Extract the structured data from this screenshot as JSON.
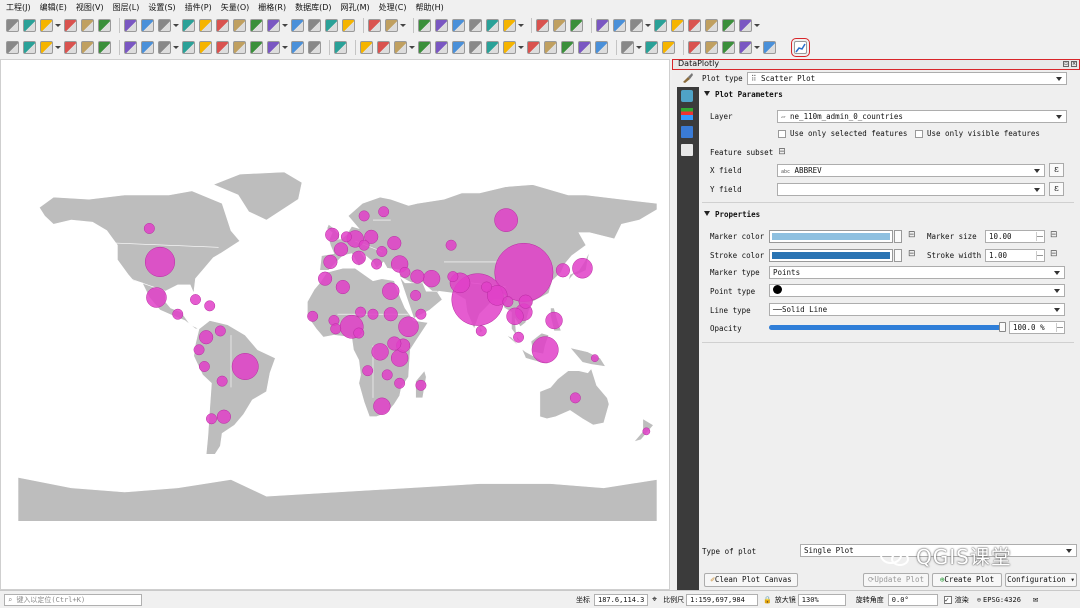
{
  "menu": [
    "工程(J)",
    "编辑(E)",
    "视图(V)",
    "图层(L)",
    "设置(S)",
    "插件(P)",
    "矢量(O)",
    "栅格(R)",
    "数据库(D)",
    "网孔(M)",
    "处理(C)",
    "帮助(H)"
  ],
  "icons": {
    "toolbar1": [
      "new-project-icon",
      "open-project-icon",
      "save-project-icon",
      "save-as-icon",
      "print-layout-icon",
      "layout-manager-icon",
      "style-manager-icon",
      "pan-icon",
      "pan-to-selection-icon",
      "zoom-in-icon",
      "zoom-out-icon",
      "zoom-full-icon",
      "zoom-to-selection-icon",
      "zoom-to-layer-icon",
      "zoom-native-icon",
      "zoom-last-icon",
      "zoom-next-icon",
      "new-bookmark-icon",
      "show-bookmarks-icon",
      "refresh-icon",
      "identify-icon",
      "run-action-icon",
      "select-features-icon",
      "attribute-table-icon",
      "field-calculator-icon",
      "processing-toolbox-icon",
      "statistical-summary-icon",
      "measure-icon",
      "map-tips-icon",
      "text-annotation-icon",
      "label-pin-icon",
      "label-show-icon",
      "label-move-icon",
      "label-rotate-icon",
      "label-change-icon",
      "diagram-pin-icon",
      "diagram-move-icon",
      "diagram-change-icon",
      "diagram-rotate-icon"
    ],
    "toolbar2": [
      "data-source-manager-icon",
      "new-geopackage-icon",
      "new-shapefile-icon",
      "new-spatialite-icon",
      "new-virtual-layer-icon",
      "add-vector-icon",
      "digitize-icon",
      "edit-pencil-icon",
      "save-edits-icon",
      "add-feature-icon",
      "vertex-tool-icon",
      "delete-selected-icon",
      "cut-features-icon",
      "copy-features-icon",
      "paste-features-icon",
      "undo-icon",
      "redo-icon",
      "db-manager-icon",
      "plot-icon",
      "geometry-tool-1",
      "geometry-tool-2",
      "geometry-tool-3",
      "geometry-tool-4",
      "geometry-tool-5",
      "geometry-tool-6",
      "geometry-tool-7",
      "geometry-tool-8",
      "geometry-tool-9",
      "geometry-tool-10",
      "geometry-tool-11",
      "geometry-tool-12",
      "geometry-tool-13",
      "help-icon",
      "python-console-icon",
      "plugin-icon",
      "shape-tool-1",
      "shape-tool-2",
      "shape-tool-3",
      "shape-tool-4",
      "shape-tool-5",
      "dataplotly-icon"
    ]
  },
  "map": {
    "land_color": "#bdbdbd",
    "marker_color": "#e040c8",
    "markers": [
      {
        "lon": 105,
        "lat": 35,
        "size": 17
      },
      {
        "lon": 79,
        "lat": 22,
        "size": 15
      },
      {
        "lon": -100,
        "lat": 40,
        "size": 8
      },
      {
        "lon": 95,
        "lat": 60,
        "size": 6
      },
      {
        "lon": 117,
        "lat": -2,
        "size": 7
      },
      {
        "lon": -52,
        "lat": -10,
        "size": 7
      },
      {
        "lon": 8,
        "lat": 9,
        "size": 6
      },
      {
        "lon": -102,
        "lat": 23,
        "size": 5
      },
      {
        "lon": 69,
        "lat": 30,
        "size": 5
      },
      {
        "lon": 90,
        "lat": 24,
        "size": 5
      },
      {
        "lon": 138,
        "lat": 37,
        "size": 5
      },
      {
        "lon": 122,
        "lat": 12,
        "size": 4
      },
      {
        "lon": 40,
        "lat": 9,
        "size": 5
      },
      {
        "lon": 24,
        "lat": -3,
        "size": 4
      },
      {
        "lon": 30,
        "lat": 26,
        "size": 4
      },
      {
        "lon": 105,
        "lat": 16,
        "size": 4
      },
      {
        "lon": 106,
        "lat": 21,
        "size": 3
      },
      {
        "lon": 10,
        "lat": 51,
        "size": 4
      },
      {
        "lon": 35,
        "lat": 39,
        "size": 4
      },
      {
        "lon": 53,
        "lat": 32,
        "size": 4
      },
      {
        "lon": 100,
        "lat": 14,
        "size": 4
      },
      {
        "lon": 2,
        "lat": 46,
        "size": 3
      },
      {
        "lon": -3,
        "lat": 53,
        "size": 3
      },
      {
        "lon": 12,
        "lat": 42,
        "size": 3
      },
      {
        "lon": 25,
        "lat": -29,
        "size": 4
      },
      {
        "lon": 35,
        "lat": -6,
        "size": 4
      },
      {
        "lon": 37,
        "lat": 0,
        "size": 3
      },
      {
        "lon": -74,
        "lat": 4,
        "size": 3
      },
      {
        "lon": -64,
        "lat": -34,
        "size": 3
      },
      {
        "lon": 127,
        "lat": 36,
        "size": 3
      },
      {
        "lon": 45,
        "lat": 33,
        "size": 3
      },
      {
        "lon": 30,
        "lat": 15,
        "size": 3
      },
      {
        "lon": 3,
        "lat": 28,
        "size": 3
      },
      {
        "lon": -7,
        "lat": 32,
        "size": 3
      },
      {
        "lon": 32,
        "lat": 1,
        "size": 3
      },
      {
        "lon": -4,
        "lat": 40,
        "size": 3
      },
      {
        "lon": 19,
        "lat": 52,
        "size": 3
      },
      {
        "lon": 32,
        "lat": 49,
        "size": 3
      },
      {
        "lon": 134,
        "lat": -25,
        "size": 2
      },
      {
        "lon": -106,
        "lat": 56,
        "size": 2
      },
      {
        "lon": 44,
        "lat": 24,
        "size": 2
      },
      {
        "lon": -75,
        "lat": -10,
        "size": 2
      },
      {
        "lon": -66,
        "lat": 7,
        "size": 2
      },
      {
        "lon": -71,
        "lat": -35,
        "size": 2
      },
      {
        "lon": 47,
        "lat": -19,
        "size": 2
      },
      {
        "lon": 17,
        "lat": -12,
        "size": 2
      },
      {
        "lon": 35,
        "lat": -18,
        "size": 2
      },
      {
        "lon": 28,
        "lat": -14,
        "size": 2
      },
      {
        "lon": 20,
        "lat": 15,
        "size": 2
      },
      {
        "lon": 13,
        "lat": 16,
        "size": 2
      },
      {
        "lon": -2,
        "lat": 12,
        "size": 2
      },
      {
        "lon": -1,
        "lat": 8,
        "size": 2
      },
      {
        "lon": -14,
        "lat": 14,
        "size": 2
      },
      {
        "lon": 12,
        "lat": 6,
        "size": 2
      },
      {
        "lon": 47,
        "lat": 15,
        "size": 2
      },
      {
        "lon": 38,
        "lat": 35,
        "size": 2
      },
      {
        "lon": 64,
        "lat": 48,
        "size": 2
      },
      {
        "lon": 65,
        "lat": 33,
        "size": 2
      },
      {
        "lon": 84,
        "lat": 28,
        "size": 2
      },
      {
        "lon": 96,
        "lat": 21,
        "size": 2
      },
      {
        "lon": 102,
        "lat": 4,
        "size": 2
      },
      {
        "lon": 81,
        "lat": 7,
        "size": 2
      },
      {
        "lon": -90,
        "lat": 15,
        "size": 2
      },
      {
        "lon": -80,
        "lat": 22,
        "size": 2
      },
      {
        "lon": -72,
        "lat": 19,
        "size": 2
      },
      {
        "lon": -78,
        "lat": -2,
        "size": 2
      },
      {
        "lon": -65,
        "lat": -17,
        "size": 2
      },
      {
        "lon": 5,
        "lat": 52,
        "size": 2
      },
      {
        "lon": 15,
        "lat": 62,
        "size": 2
      },
      {
        "lon": 26,
        "lat": 64,
        "size": 2
      },
      {
        "lon": 25,
        "lat": 45,
        "size": 2
      },
      {
        "lon": 22,
        "lat": 39,
        "size": 2
      },
      {
        "lon": 15,
        "lat": 48,
        "size": 2
      },
      {
        "lon": 145,
        "lat": -6,
        "size": 1
      },
      {
        "lon": 174,
        "lat": -41,
        "size": 1
      }
    ]
  },
  "panel": {
    "title": "DataPlotly",
    "plot_type_label": "Plot type",
    "plot_type_value": "Scatter Plot",
    "plot_params_header": "Plot Parameters",
    "layer_label": "Layer",
    "layer_value": "ne_110m_admin_0_countries",
    "use_selected_label": "Use only selected features",
    "use_visible_label": "Use only visible features",
    "feature_subset_label": "Feature subset",
    "x_field_label": "X field",
    "x_field_value": "ABBREV",
    "x_field_type": "abc",
    "y_field_label": "Y field",
    "y_field_value": "",
    "expression_symbol": "ε",
    "properties_header": "Properties",
    "marker_color_label": "Marker color",
    "marker_color": "#8ec0e0",
    "marker_size_label": "Marker size",
    "marker_size_value": "10.00",
    "stroke_color_label": "Stroke color",
    "stroke_color": "#2a74b3",
    "stroke_width_label": "Stroke width",
    "stroke_width_value": "1.00",
    "marker_type_label": "Marker type",
    "marker_type_value": "Points",
    "point_type_label": "Point type",
    "line_type_label": "Line type",
    "line_type_value": "Solid Line",
    "opacity_label": "Opacity",
    "opacity_fraction": 1.0,
    "opacity_value": "100.0 %",
    "type_of_plot_label": "Type of plot",
    "type_of_plot_value": "Single Plot",
    "clean_button": "Clean Plot Canvas",
    "update_button": "Update Plot",
    "create_button": "Create Plot",
    "configuration_button": "Configuration"
  },
  "watermark": "QGIS课堂",
  "status": {
    "locator_placeholder": "键入以定位(Ctrl+K)",
    "coord_label": "坐标",
    "coord_value": "187.6,114.3",
    "scale_label": "比例尺",
    "scale_value": "1:159,697,984",
    "magnifier_label": "放大镜",
    "magnifier_value": "130%",
    "rotation_label": "旋转角度",
    "rotation_value": "0.0°",
    "render_label": "渲染",
    "crs_value": "EPSG:4326"
  }
}
